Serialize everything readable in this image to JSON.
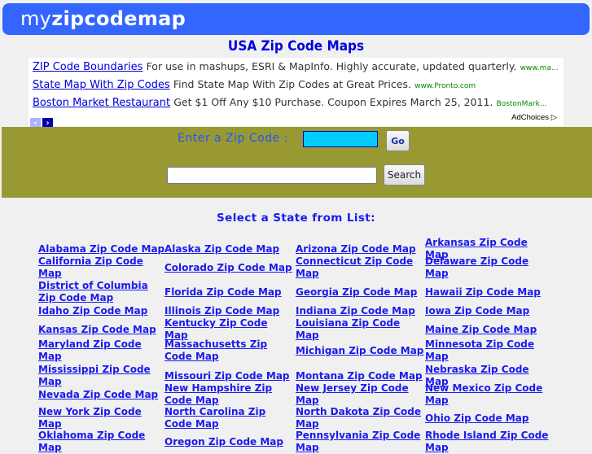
{
  "header": {
    "logo_my": "my",
    "logo_rest": "zipcodemap"
  },
  "page_title": "USA Zip Code Maps",
  "ads": [
    {
      "link": "ZIP Code Boundaries",
      "text": "For use in mashups, ESRI & MapInfo. Highly accurate, updated quarterly.",
      "url": "www.ma..."
    },
    {
      "link": "State Map With Zip Codes",
      "text": "Find State Map With Zip Codes at Great Prices.",
      "url": "www.Pronto.com"
    },
    {
      "link": "Boston Market Restaurant",
      "text": "Get $1 Off Any $10 Purchase. Coupon Expires March 25, 2011.",
      "url": "BostonMark..."
    }
  ],
  "ad_nav": {
    "prev": "‹",
    "next": "›"
  },
  "adchoices": "AdChoices ▷",
  "zip_search": {
    "label": "Enter a Zip Code :",
    "value": "",
    "go_label": "Go"
  },
  "site_search": {
    "value": "",
    "button_label": "Search"
  },
  "select_label": "Select a State from List:",
  "states": [
    [
      "Alabama Zip Code Map",
      "Alaska Zip Code Map",
      "Arizona Zip Code Map",
      "Arkansas Zip Code Map"
    ],
    [
      "California Zip Code Map",
      "Colorado Zip Code Map",
      "Connecticut Zip Code Map",
      "Delaware Zip Code Map"
    ],
    [
      "District of Columbia Zip Code Map",
      "Florida Zip Code Map",
      "Georgia Zip Code Map",
      "Hawaii Zip Code Map"
    ],
    [
      "Idaho Zip Code Map",
      "Illinois Zip Code Map",
      "Indiana Zip Code Map",
      "Iowa Zip Code Map"
    ],
    [
      "Kansas Zip Code Map",
      "Kentucky Zip Code Map",
      "Louisiana Zip Code Map",
      "Maine Zip Code Map"
    ],
    [
      "Maryland Zip Code Map",
      "Massachusetts Zip Code Map",
      "Michigan Zip Code Map",
      "Minnesota Zip Code Map"
    ],
    [
      "Mississippi Zip Code Map",
      "Missouri Zip Code Map",
      "Montana Zip Code Map",
      "Nebraska Zip Code Map"
    ],
    [
      "Nevada Zip Code Map",
      "New Hampshire Zip Code Map",
      "New Jersey Zip Code Map",
      "New Mexico Zip Code Map"
    ],
    [
      "New York Zip Code Map",
      "North Carolina Zip Code Map",
      "North Dakota Zip Code Map",
      "Ohio Zip Code Map"
    ],
    [
      "Oklahoma Zip Code Map",
      "Oregon Zip Code Map",
      "Pennsylvania Zip Code Map",
      "Rhode Island Zip Code Map"
    ]
  ]
}
